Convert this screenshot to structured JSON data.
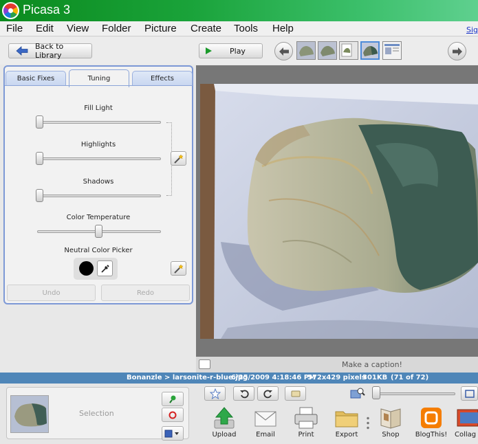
{
  "app": {
    "title": "Picasa 3"
  },
  "menu": {
    "items": [
      "File",
      "Edit",
      "View",
      "Folder",
      "Picture",
      "Create",
      "Tools",
      "Help"
    ],
    "signin": "Sig"
  },
  "toolbar": {
    "back_label": "Back to Library",
    "play_label": "Play"
  },
  "edit_panel": {
    "tabs": [
      "Basic Fixes",
      "Tuning",
      "Effects"
    ],
    "active_tab": "Tuning",
    "sliders": [
      {
        "label": "Fill Light",
        "value": 0
      },
      {
        "label": "Highlights",
        "value": 0
      },
      {
        "label": "Shadows",
        "value": 0
      },
      {
        "label": "Color Temperature",
        "value": 0.5
      }
    ],
    "neutral_label": "Neutral Color Picker",
    "undo_label": "Undo",
    "redo_label": "Redo"
  },
  "viewer": {
    "caption_placeholder": "Make a caption!"
  },
  "status": {
    "path": "Bonanzle > larsonite-r-blue.jpg",
    "date": "6/25/2009 4:18:46 PM",
    "dimensions": "572x429 pixels",
    "size": "301KB",
    "position": "(71 of 72)"
  },
  "tray": {
    "selection_label": "Selection",
    "actions": [
      "Upload",
      "Email",
      "Print",
      "Export",
      "Shop",
      "BlogThis!",
      "Collag"
    ]
  },
  "colors": {
    "title_green": "#1aa33a",
    "status_blue": "#4f86b8",
    "panel_border": "#7c98d6"
  }
}
